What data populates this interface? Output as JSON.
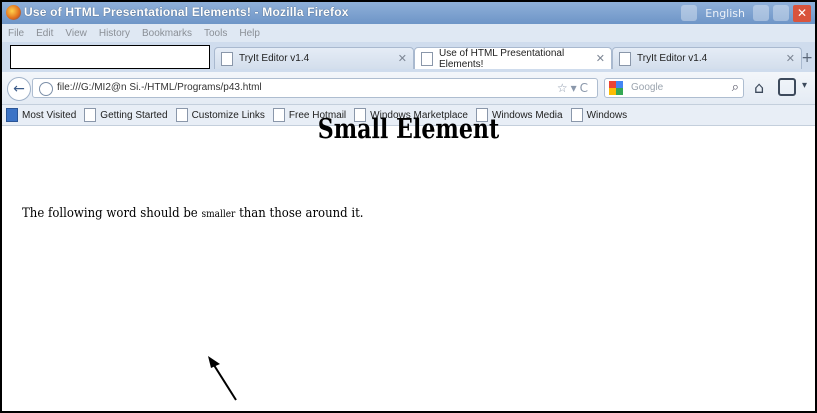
{
  "window": {
    "title": "Use of HTML Presentational Elements! - Mozilla Firefox",
    "tray_language": "English"
  },
  "menu": [
    "File",
    "Edit",
    "View",
    "History",
    "Bookmarks",
    "Tools",
    "Help"
  ],
  "tabs": [
    {
      "label": "TryIt Editor v1.4",
      "active": false
    },
    {
      "label": "Use of HTML Presentational Elements!",
      "active": true
    },
    {
      "label": "TryIt Editor v1.4",
      "active": false
    }
  ],
  "navbar": {
    "url": "file:///G:/MI2@n Si.-/HTML/Programs/p43.html",
    "search_placeholder": "Google"
  },
  "bookmarks": [
    "Most Visited",
    "Getting Started",
    "Customize Links",
    "Free Hotmail",
    "Windows Marketplace",
    "Windows Media",
    "Windows"
  ],
  "page": {
    "heading": "Small Element",
    "para_before": "The following word should be ",
    "para_small": "smaller",
    "para_after": " than those around it."
  },
  "icons": {
    "app": "firefox-icon",
    "back": "back-arrow-icon",
    "home": "home-icon",
    "search": "magnifier-icon",
    "annotation": "pointer-arrow-icon"
  }
}
